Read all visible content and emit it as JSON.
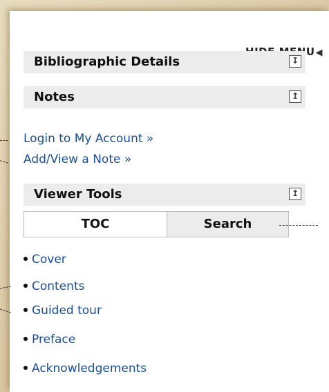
{
  "menu": {
    "hide_label": "HIDE MENU",
    "hide_icon": "triangle-left-icon"
  },
  "sections": {
    "bibliographic": {
      "title": "Bibliographic Details",
      "icon": "download-icon"
    },
    "notes": {
      "title": "Notes",
      "icon": "collapse-up-icon"
    },
    "viewer_tools": {
      "title": "Viewer Tools",
      "icon": "collapse-up-icon"
    }
  },
  "notes_links": {
    "login": "Login to My Account »",
    "add_note": "Add/View a Note »"
  },
  "tabs": {
    "toc": "TOC",
    "search": "Search"
  },
  "toc_items": [
    "Cover",
    "Contents",
    "Guided tour",
    "Preface",
    "Acknowledgements"
  ]
}
